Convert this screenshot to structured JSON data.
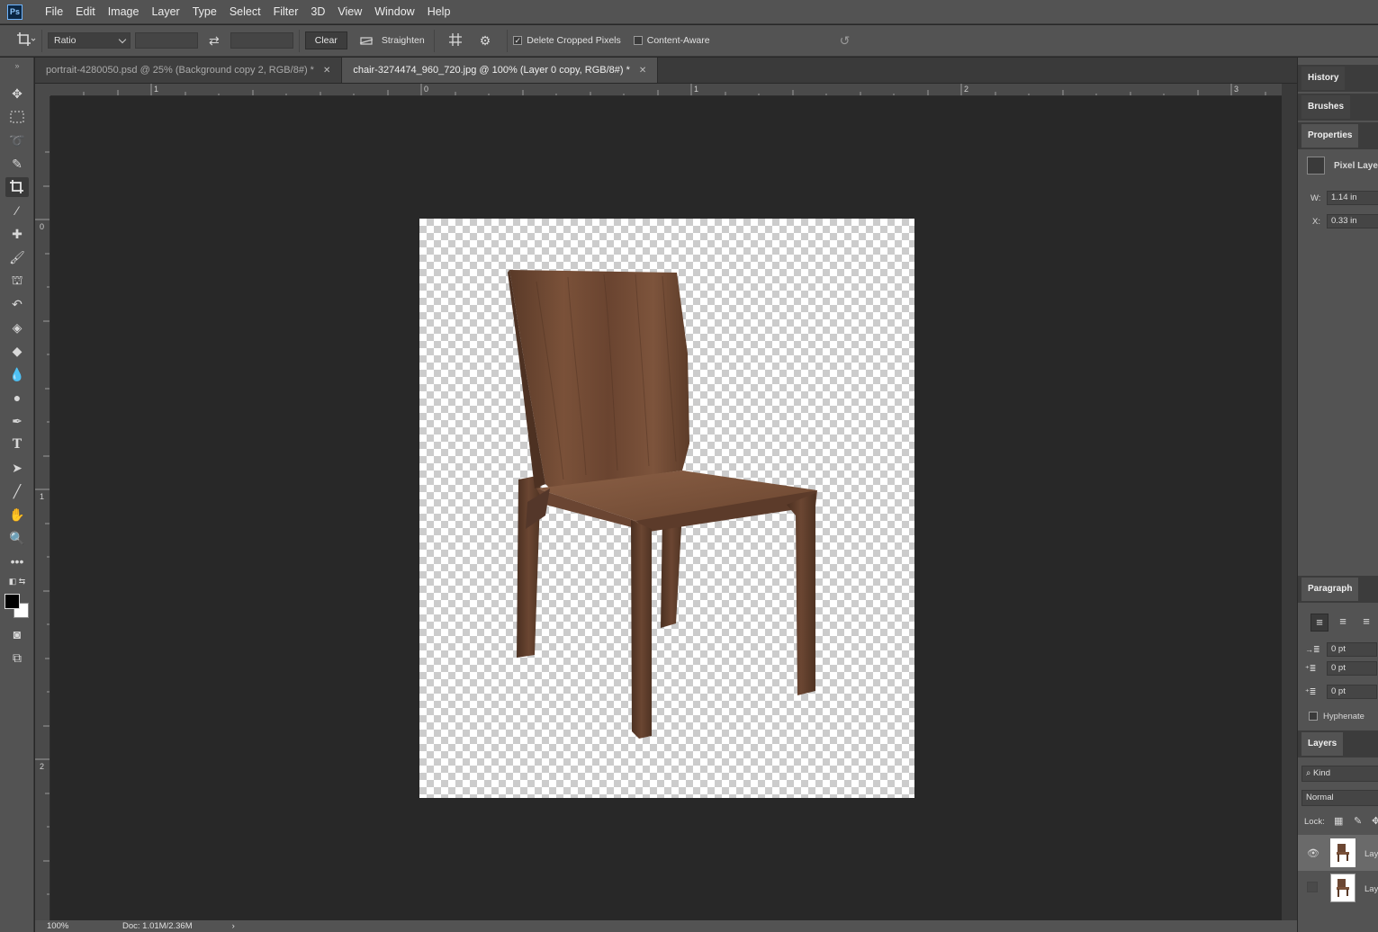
{
  "menu": [
    "File",
    "Edit",
    "Image",
    "Layer",
    "Type",
    "Select",
    "Filter",
    "3D",
    "View",
    "Window",
    "Help"
  ],
  "app_logo": "Ps",
  "options": {
    "ratio_select": "Ratio",
    "clear_label": "Clear",
    "straighten_label": "Straighten",
    "delete_cropped_label": "Delete Cropped Pixels",
    "delete_cropped_checked": true,
    "content_aware_label": "Content-Aware",
    "content_aware_checked": false
  },
  "tabs": [
    {
      "label": "portrait-4280050.psd @ 25% (Background copy 2, RGB/8#) *",
      "active": false
    },
    {
      "label": "chair-3274474_960_720.jpg @ 100% (Layer 0 copy, RGB/8#) *",
      "active": true
    }
  ],
  "rulers": {
    "top": [
      "1",
      "0",
      "1",
      "2",
      "3"
    ],
    "left": [
      "0",
      "1",
      "2"
    ]
  },
  "status": {
    "zoom": "100%",
    "doc": "Doc: 1.01M/2.36M",
    "arrow": "›"
  },
  "panels": {
    "history": "History",
    "brushes": "Brushes",
    "properties": "Properties",
    "pixel_layer": "Pixel Laye",
    "w_label": "W:",
    "w_value": "1.14 in",
    "x_label": "X:",
    "x_value": "0.33 in",
    "paragraph": "Paragraph",
    "indent_values": [
      "0 pt",
      "0 pt",
      "0 pt"
    ],
    "hyphenate": "Hyphenate",
    "layers": "Layers",
    "kind": "Kind",
    "blend_mode": "Normal",
    "lock_label": "Lock:",
    "layer_names": [
      "Lay",
      "Lay"
    ]
  },
  "colors": {
    "foreground": "#000000",
    "background": "#ffffff",
    "wood": "#6b4632"
  }
}
